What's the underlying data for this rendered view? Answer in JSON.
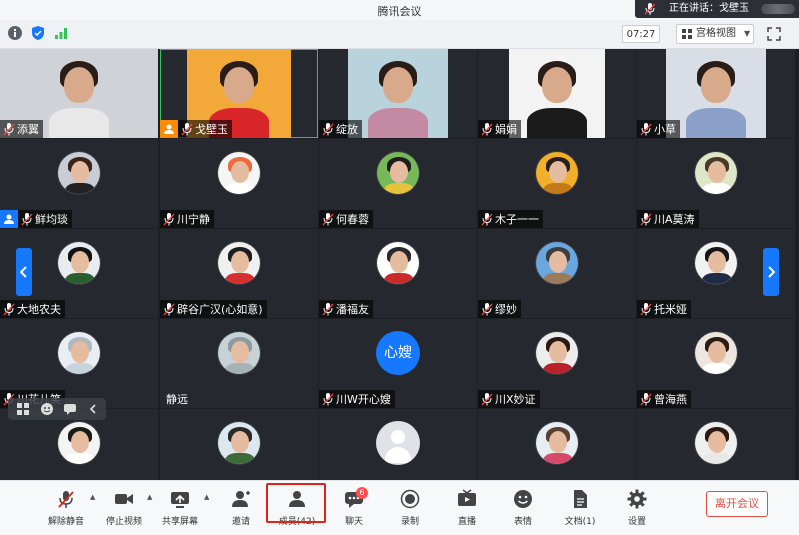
{
  "app": {
    "title": "腾讯会议",
    "speaking_label": "正在讲话：戈壁玉"
  },
  "toolbar": {
    "timer": "07:27",
    "view_label": "宫格视图"
  },
  "tiles": [
    {
      "name": "添翼",
      "kind": "video",
      "bg": "#cfd3d7",
      "body": "#e8e8e8"
    },
    {
      "name": "戈壁玉",
      "kind": "video",
      "bg": "#f2a93a",
      "body": "#d8262a",
      "host": "orange",
      "active": true
    },
    {
      "name": "绽放",
      "kind": "video",
      "bg": "#b9d3dd",
      "body": "#c48aa4"
    },
    {
      "name": "娟娟",
      "kind": "video",
      "bg": "#f3f3f3",
      "body": "#1b1b1b"
    },
    {
      "name": "小草",
      "kind": "video",
      "bg": "#d8dde6",
      "body": "#8aa0c8"
    },
    {
      "name": "鲜均琰",
      "kind": "avatar",
      "bg": "#c8ccd4",
      "hair": "#3a2419",
      "body": "#222222",
      "host": "blue"
    },
    {
      "name": "川宁静",
      "kind": "avatar",
      "bg": "#f5f5f5",
      "hair": "#f06a3c",
      "body": "#ffffff"
    },
    {
      "name": "何春蓉",
      "kind": "avatar",
      "bg": "#76b85a",
      "hair": "#1e1e1e",
      "body": "#e6c33a"
    },
    {
      "name": "木子一一",
      "kind": "avatar",
      "bg": "#f2b02a",
      "hair": "#2a2018",
      "body": "#c57a1a"
    },
    {
      "name": "川A莫涛",
      "kind": "avatar",
      "bg": "#dfe6c8",
      "hair": "#4a3a28",
      "body": "#ffffff"
    },
    {
      "name": "大地农夫",
      "kind": "avatar",
      "bg": "#e9ecef",
      "hair": "#121212",
      "body": "#2a5e2e"
    },
    {
      "name": "辟谷广汉(心如意)",
      "kind": "avatar",
      "bg": "#f0f0f0",
      "hair": "#1e1e1e",
      "body": "#d62f2f"
    },
    {
      "name": "潘福友",
      "kind": "avatar",
      "bg": "#ffffff",
      "hair": "#2a2a2a",
      "body": "#c92b2b"
    },
    {
      "name": "缪妙",
      "kind": "avatar",
      "bg": "#6aa7de",
      "hair": "#3d3d3d",
      "body": "#9c7a5a"
    },
    {
      "name": "托米娅",
      "kind": "avatar",
      "bg": "#f2f2f2",
      "hair": "#161616",
      "body": "#1f2a44"
    },
    {
      "name": "川花儿笑",
      "kind": "avatar",
      "bg": "#e8eef4",
      "hair": "#b0b8c0",
      "body": "#c9d3dc"
    },
    {
      "name": "静远",
      "kind": "avatar",
      "bg": "#c7d2d6",
      "hair": "#8c9aa0",
      "body": "#a6b2b6",
      "bare": true
    },
    {
      "name": "川W开心嫂",
      "kind": "text",
      "text": "心嫂"
    },
    {
      "name": "川X妙证",
      "kind": "avatar",
      "bg": "#ededed",
      "hair": "#2a1a14",
      "body": "#b8202a"
    },
    {
      "name": "曾海燕",
      "kind": "avatar",
      "bg": "#ece6de",
      "hair": "#2a1c14",
      "body": "#ffffff"
    },
    {
      "name": "",
      "kind": "avatar",
      "bg": "#f4f4f4",
      "hair": "#1a1a1a",
      "body": "#ffffff"
    },
    {
      "name": "",
      "kind": "avatar",
      "bg": "#dde7ef",
      "hair": "#2a2a2a",
      "body": "#3d6b3a"
    },
    {
      "name": "",
      "kind": "default"
    },
    {
      "name": "",
      "kind": "avatar",
      "bg": "#e6eef4",
      "hair": "#5a4030",
      "body": "#d64a6a"
    },
    {
      "name": "",
      "kind": "avatar",
      "bg": "#efefef",
      "hair": "#2a1a10",
      "body": "#e8e8e8"
    }
  ],
  "bottom": {
    "unmute": "解除静音",
    "stop_video": "停止视频",
    "share": "共享屏幕",
    "invite": "邀请",
    "members": "成员(42)",
    "chat": "聊天",
    "chat_badge": "6",
    "record": "录制",
    "live": "直播",
    "emoji": "表情",
    "docs": "文档(1)",
    "settings": "设置",
    "leave": "离开会议"
  },
  "colors": {
    "accent": "#1677ff",
    "active_border": "#33c35a",
    "leave_red": "#e24d43",
    "highlight_red": "#e0241b"
  }
}
